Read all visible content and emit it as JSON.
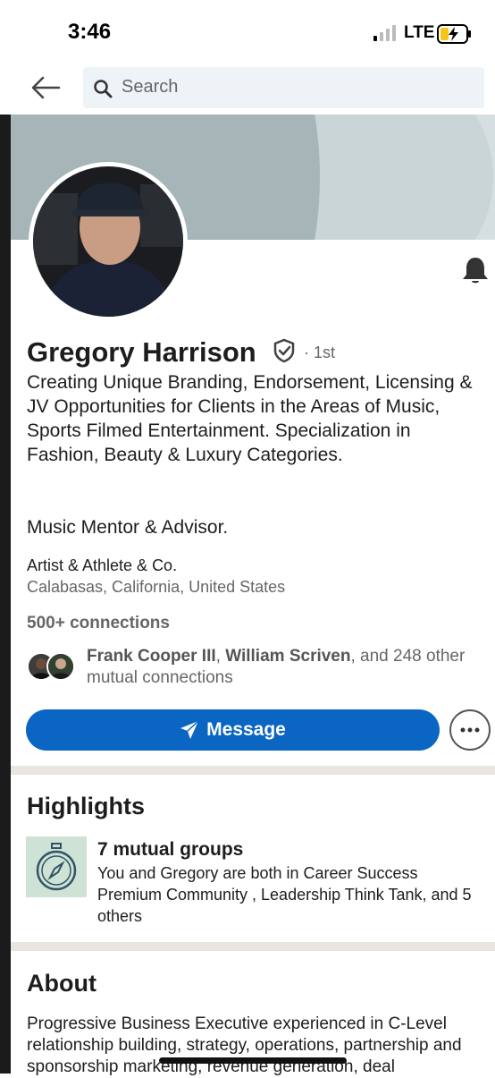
{
  "status_bar": {
    "time": "3:46",
    "carrier": "LTE"
  },
  "nav": {
    "search_placeholder": "Search"
  },
  "profile": {
    "name": "Gregory Harrison",
    "degree": "· 1st",
    "headline": "Creating Unique Branding, Endorsement, Licensing & JV Opportunities for Clients in the Areas of Music, Sports Filmed Entertainment. Specialization in Fashion, Beauty & Luxury Categories.",
    "headline2": "Music Mentor & Advisor.",
    "company": "Artist & Athlete & Co.",
    "location": "Calabasas, California, United States",
    "connections": "500+ connections",
    "mutual": {
      "name1": "Frank Cooper III",
      "sep": ", ",
      "name2": "William Scriven",
      "rest": ", and 248 other mutual connections"
    },
    "message_label": "Message"
  },
  "highlights": {
    "title": "Highlights",
    "groups_title": "7 mutual groups",
    "groups_desc": "You and Gregory are both in Career Success Premium Community , Leadership Think Tank, and 5 others"
  },
  "about": {
    "title": "About",
    "text": "Progressive Business Executive experienced in C-Level relationship building, strategy, operations, partnership and sponsorship marketing, revenue generation, deal"
  },
  "colors": {
    "brand": "#0a66c2",
    "divider": "#e9e5df"
  },
  "icons": [
    "back-arrow-icon",
    "search-icon",
    "bell-icon",
    "verified-shield-icon",
    "send-icon",
    "more-icon",
    "compass-icon"
  ]
}
